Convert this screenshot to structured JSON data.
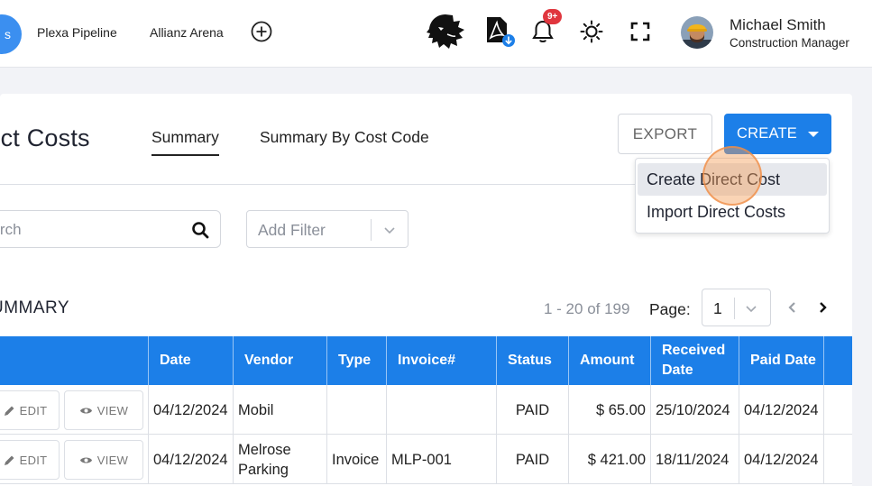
{
  "header": {
    "project_pill": "s",
    "nav_links": [
      "Plexa Pipeline",
      "Allianz Arena"
    ],
    "notification_badge": "9+",
    "user_name": "Michael Smith",
    "user_role": "Construction Manager"
  },
  "page": {
    "title": "irect Costs",
    "tabs": [
      "Summary",
      "Summary By Cost Code"
    ],
    "active_tab": "Summary",
    "export_label": "EXPORT",
    "create_label": "CREATE",
    "create_menu": [
      "Create Direct Cost",
      "Import Direct Costs"
    ],
    "hovered_menu_item": "Create Direct Cost"
  },
  "filters": {
    "search_placeholder": "earch",
    "filter_placeholder": "Add Filter"
  },
  "summary": {
    "title": "UMMARY",
    "range": "1 - 20 of 199",
    "page_label": "Page:",
    "page_value": "1"
  },
  "table": {
    "columns": [
      "Date",
      "Vendor",
      "Type",
      "Invoice#",
      "Status",
      "Amount",
      "Received Date",
      "Paid Date"
    ],
    "edit_label": "EDIT",
    "view_label": "VIEW",
    "rows": [
      {
        "date": "04/12/2024",
        "vendor": "Mobil",
        "type": "",
        "invoice": "",
        "status": "PAID",
        "amount": "$ 65.00",
        "received": "25/10/2024",
        "paid": "04/12/2024"
      },
      {
        "date": "04/12/2024",
        "vendor": "Melrose Parking",
        "type": "Invoice",
        "invoice": "MLP-001",
        "status": "PAID",
        "amount": "$ 421.00",
        "received": "18/11/2024",
        "paid": "04/12/2024"
      }
    ]
  },
  "colors": {
    "primary": "#1c7fe8",
    "badge": "#e0363e",
    "click_indicator": "#f5a05a"
  },
  "icons": [
    "plus-circle-icon",
    "lion-logo-icon",
    "pdf-download-icon",
    "bell-icon",
    "brightness-icon",
    "fullscreen-icon",
    "search-icon",
    "chevron-down-icon",
    "chevron-left-icon",
    "chevron-right-icon",
    "pencil-icon",
    "eye-icon"
  ]
}
